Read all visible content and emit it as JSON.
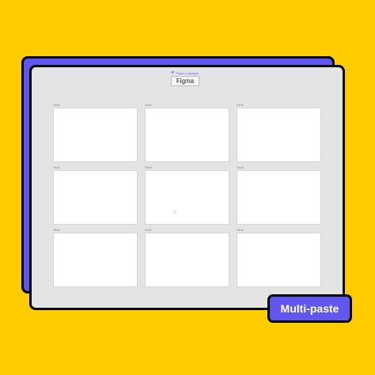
{
  "logo_component": {
    "label": "Figma Logotype",
    "icon": "component-icon",
    "text": "Figma"
  },
  "slides": [
    {
      "label": "Slide"
    },
    {
      "label": "Slide"
    },
    {
      "label": "Slide"
    },
    {
      "label": "Slide"
    },
    {
      "label": "Slide"
    },
    {
      "label": "Slide"
    },
    {
      "label": "Slide"
    },
    {
      "label": "Slide"
    },
    {
      "label": "Slide"
    }
  ],
  "badge": {
    "label": "Multi-paste"
  },
  "colors": {
    "background": "#FFCC00",
    "accent": "#6157F0",
    "canvas": "#E4E4E4",
    "component": "#7B61FF"
  }
}
